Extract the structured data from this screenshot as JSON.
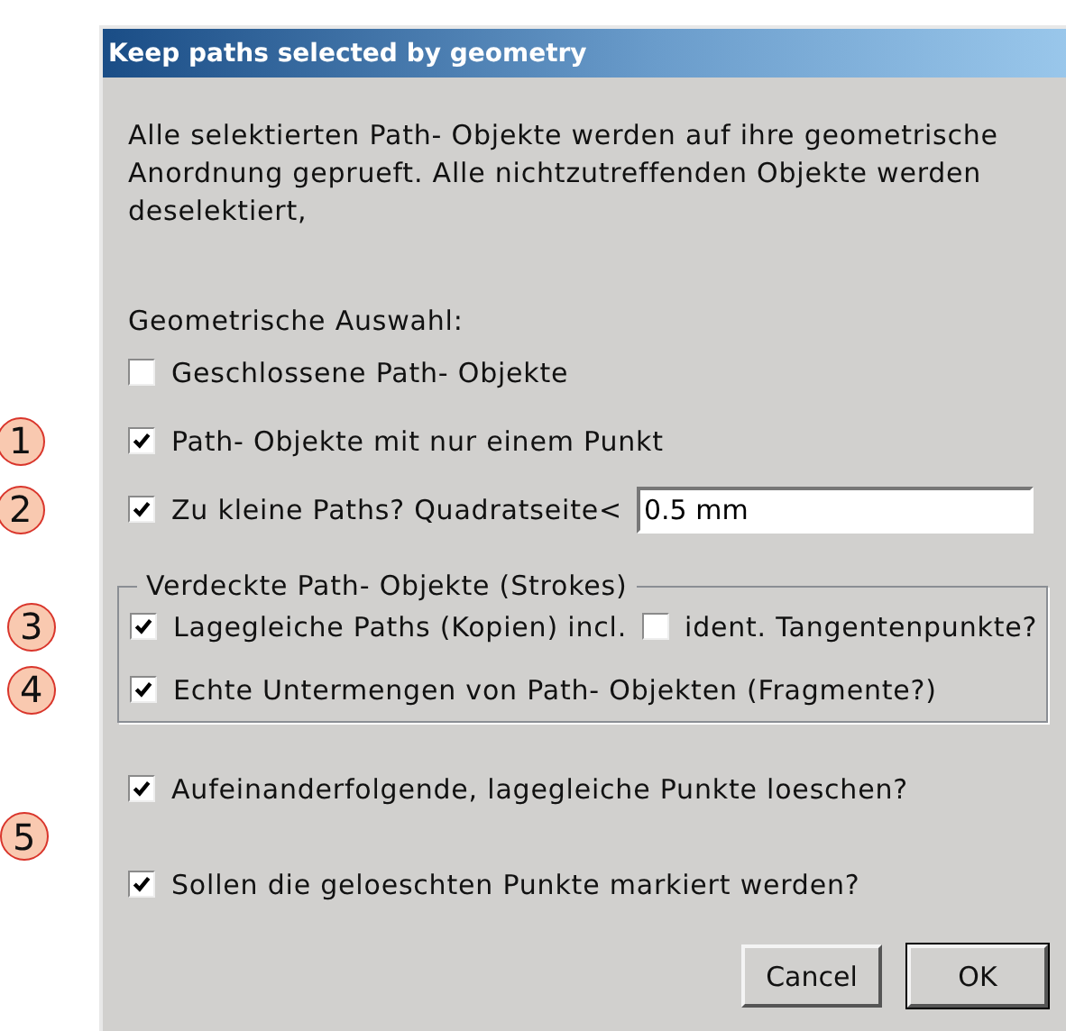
{
  "dialog": {
    "title": "Keep paths selected by geometry"
  },
  "description": "Alle selektierten Path- Objekte werden auf ihre geometrische Anordnung geprueft. Alle nichtzutreffenden Objekte werden deselektiert,",
  "section_label": "Geometrische Auswahl:",
  "options": [
    {
      "kind": "checkbox",
      "label": "Geschlossene Path- Objekte",
      "checked": false
    },
    {
      "kind": "checkbox",
      "label": "Path- Objekte mit nur einem Punkt",
      "checked": true,
      "callout": "1"
    },
    {
      "kind": "checkbox_field",
      "label": "Zu kleine Paths?  Quadratseite<",
      "checked": true,
      "value": "0.5 mm",
      "callout": "2"
    }
  ],
  "group": {
    "title": "Verdeckte Path- Objekte (Strokes)",
    "options": [
      {
        "kind": "checkbox_pair",
        "label": "Lagegleiche Paths (Kopien) incl.",
        "checked": true,
        "second_label": "ident. Tangentenpunkte?",
        "second_checked": false,
        "callout": "3"
      },
      {
        "kind": "checkbox",
        "label": "Echte Untermengen von Path- Objekten (Fragmente?)",
        "checked": true,
        "callout": "4"
      }
    ]
  },
  "point_options": {
    "callout": "5",
    "options": [
      {
        "kind": "checkbox",
        "label": "Aufeinanderfolgende, lagegleiche Punkte loeschen?",
        "checked": true
      },
      {
        "kind": "checkbox",
        "label": "Sollen die geloeschten Punkte markiert werden?",
        "checked": true
      }
    ]
  },
  "buttons": [
    {
      "label": "Cancel",
      "default": false
    },
    {
      "label": "OK",
      "default": true
    }
  ]
}
